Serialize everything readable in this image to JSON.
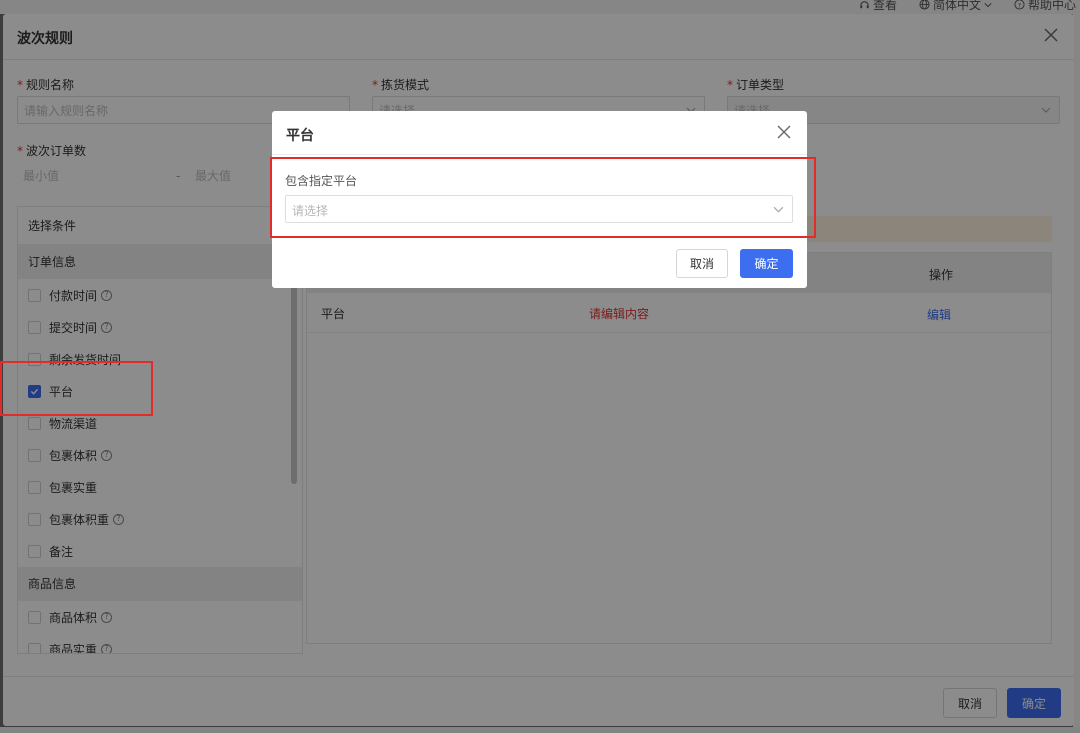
{
  "topbar": {
    "links": [
      "查看",
      "简体中文",
      "帮助中心"
    ]
  },
  "dialog": {
    "title": "波次规则",
    "fields": {
      "rule_name": {
        "label": "规则名称",
        "placeholder": "请输入规则名称"
      },
      "picking_mode": {
        "label": "拣货模式",
        "placeholder": "请选择"
      },
      "order_type": {
        "label": "订单类型",
        "placeholder": "请选择"
      },
      "wave_orders": {
        "label": "波次订单数",
        "min_placeholder": "最小值",
        "separator": "-",
        "max_placeholder": "最大值"
      }
    },
    "conditions": {
      "header": "选择条件",
      "groups": [
        {
          "name": "订单信息",
          "items": [
            {
              "label": "付款时间",
              "help": true,
              "checked": false
            },
            {
              "label": "提交时间",
              "help": true,
              "checked": false
            },
            {
              "label": "剩余发货时间",
              "help": false,
              "checked": false
            },
            {
              "label": "平台",
              "help": false,
              "checked": true
            },
            {
              "label": "物流渠道",
              "help": false,
              "checked": false
            },
            {
              "label": "包裹体积",
              "help": true,
              "checked": false
            },
            {
              "label": "包裹实重",
              "help": false,
              "checked": false
            },
            {
              "label": "包裹体积重",
              "help": true,
              "checked": false
            },
            {
              "label": "备注",
              "help": false,
              "checked": false
            }
          ]
        },
        {
          "name": "商品信息",
          "items": [
            {
              "label": "商品体积",
              "help": true,
              "checked": false
            },
            {
              "label": "商品实重",
              "help": true,
              "checked": false
            }
          ]
        }
      ]
    },
    "table": {
      "op_header": "操作",
      "rows": [
        {
          "name": "平台",
          "value": "请编辑内容",
          "action": "编辑"
        }
      ]
    },
    "footer": {
      "cancel": "取消",
      "confirm": "确定"
    }
  },
  "popup": {
    "title": "平台",
    "field_label": "包含指定平台",
    "select_placeholder": "请选择",
    "cancel": "取消",
    "confirm": "确定"
  },
  "colors": {
    "primary": "#3d6ef0",
    "danger": "#e03333",
    "highlight": "#e22b2b",
    "tip_bg": "#fdf3e2"
  }
}
